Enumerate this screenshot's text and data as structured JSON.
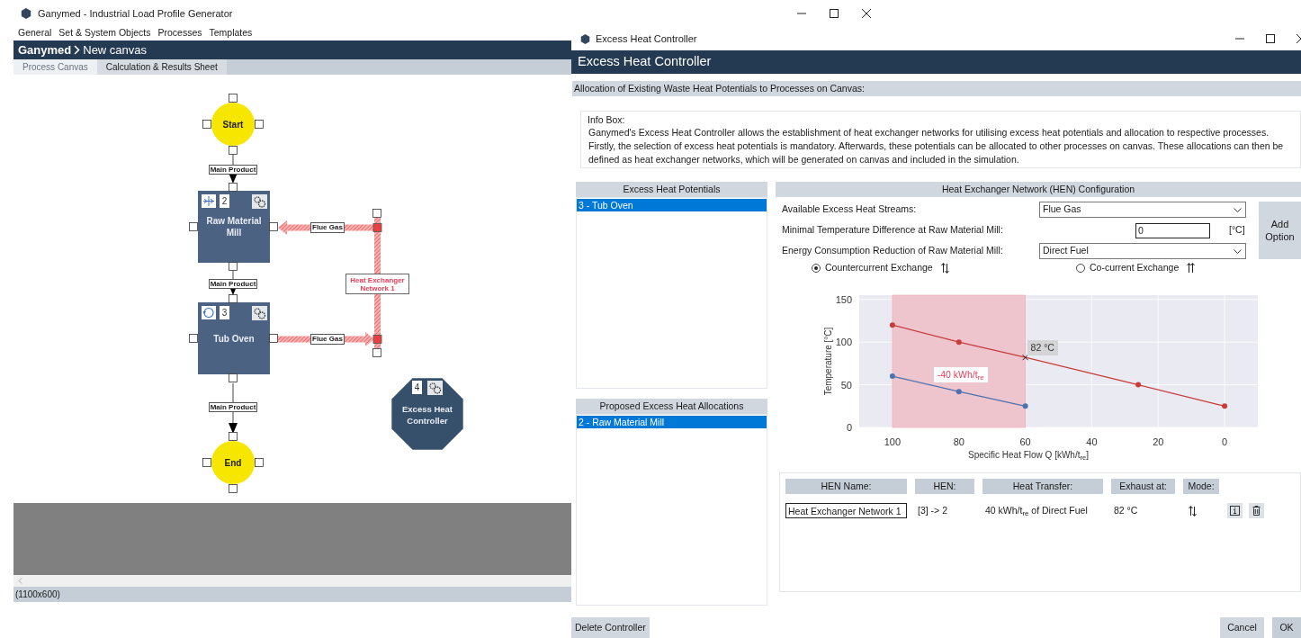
{
  "main_window": {
    "title": "Ganymed - Industrial Load Profile Generator",
    "menu": [
      "General",
      "Set & System Objects",
      "Processes",
      "Templates"
    ],
    "breadcrumb": {
      "root": "Ganymed",
      "page": "New canvas"
    },
    "tabs": [
      {
        "label": "Process Canvas",
        "selected": true
      },
      {
        "label": "Calculation & Results Sheet",
        "selected": false
      }
    ],
    "canvas": {
      "nodes": [
        {
          "kind": "terminal",
          "label": "Start"
        },
        {
          "kind": "process",
          "label": "Raw Material Mill",
          "number": "2"
        },
        {
          "kind": "process",
          "label": "Tub Oven",
          "number": "3"
        },
        {
          "kind": "terminal",
          "label": "End"
        },
        {
          "kind": "controller",
          "label": "Excess Heat Controller",
          "number": "4"
        }
      ],
      "flows": [
        {
          "label": "Main Product"
        },
        {
          "label": "Main Product"
        },
        {
          "label": "Main Product"
        }
      ],
      "heat_streams": [
        {
          "label": "Flue Gas"
        },
        {
          "label": "Flue Gas"
        }
      ],
      "networks": [
        {
          "label": "Heat Exchanger Network 1"
        }
      ]
    },
    "status": "(1100x600)"
  },
  "dialog": {
    "title": "Excess Heat Controller",
    "header": "Excess Heat Controller",
    "section": "Allocation of Existing Waste Heat Potentials to Processes on Canvas:",
    "info_box": {
      "title": "Info Box:",
      "text": "Ganymed's Excess Heat Controller allows the establishment of heat exchanger networks for utilising excess heat potentials and allocation to respective processes. Firstly, the selection of excess heat potentials is mandatory. Afterwards, these potentials can be allocated to other processes on canvas. These allocations can then be defined as heat exchanger networks, which will be generated on canvas and included in the simulation."
    },
    "potentials": {
      "title": "Excess Heat Potentials",
      "items": [
        {
          "label": "3 - Tub Oven",
          "selected": true
        }
      ]
    },
    "allocations": {
      "title": "Proposed Excess Heat Allocations",
      "items": [
        {
          "label": "2 - Raw Material Mill",
          "selected": true
        }
      ]
    },
    "hen_config": {
      "title": "Heat Exchanger Network (HEN) Configuration",
      "fields": [
        {
          "kind": "dropdown",
          "label": "Available Excess Heat Streams:",
          "value": "Flue Gas"
        },
        {
          "kind": "number",
          "label": "Minimal Temperature Difference at Raw Material Mill:",
          "value": "0",
          "unit": "[°C]"
        },
        {
          "kind": "dropdown",
          "label": "Energy Consumption Reduction of Raw Material Mill:",
          "value": "Direct Fuel"
        }
      ],
      "add_button": "Add Option",
      "modes": [
        {
          "kind": "countercurrent",
          "label": "Countercurrent Exchange",
          "selected": true
        },
        {
          "kind": "cocurrent",
          "label": "Co-current Exchange",
          "selected": false
        }
      ],
      "chart_data": {
        "type": "line",
        "xlabel": "Specific Heat Flow Q [kWh/t$_{re}$]",
        "ylabel": "Temperature [°C]",
        "x": [
          100,
          80,
          60,
          26,
          0
        ],
        "series": [
          {
            "color": "#c83c3c",
            "marker": "o",
            "values": [
              120,
              100,
              82,
              50,
              25
            ]
          },
          {
            "color": "#4c72b0",
            "marker": "o",
            "values": [
              60,
              42,
              25,
              null,
              null
            ]
          }
        ],
        "grid": true,
        "bands": [
          {
            "axis": "x",
            "from": 100,
            "to": 60
          }
        ],
        "xlim": [
          110,
          -10
        ],
        "ylim": [
          0,
          155
        ],
        "xticks": [
          100,
          80,
          60,
          40,
          20,
          0
        ],
        "yticks": [
          0,
          50,
          100,
          150
        ],
        "annotations": [
          {
            "x": 60,
            "y": 82,
            "text": "82 °C"
          },
          "-40 kWh/t$_{re}$"
        ]
      }
    },
    "hen_table": {
      "columns": [
        "HEN Name:",
        "HEN:",
        "Heat Transfer:",
        "Exhaust at:",
        "Mode:"
      ],
      "rows": [
        {
          "name": "Heat Exchanger Network 1",
          "hen": "[3] -> 2",
          "transfer": "40 kWh/t$_{re}$ of Direct Fuel",
          "exhaust": "82 °C",
          "kind": "countercurrent"
        }
      ]
    },
    "buttons": {
      "delete": "Delete Controller",
      "cancel": "Cancel",
      "ok": "OK"
    }
  }
}
